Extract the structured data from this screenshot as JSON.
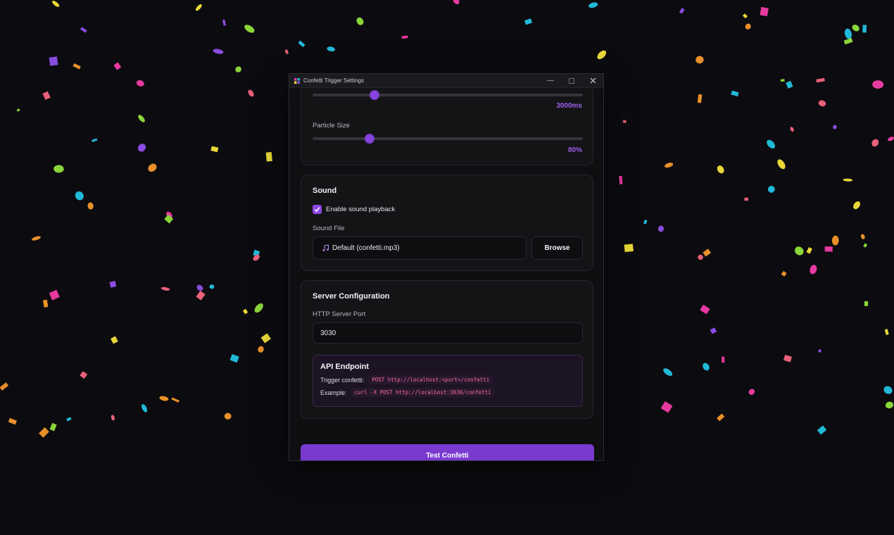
{
  "window": {
    "title": "Confetti Trigger Settings"
  },
  "sliders": [
    {
      "label": "",
      "value_text": "3000ms",
      "fraction": 0.23
    },
    {
      "label": "Particle Size",
      "value_text": "80%",
      "fraction": 0.21
    }
  ],
  "sound": {
    "title": "Sound",
    "enable_label": "Enable sound playback",
    "enabled": true,
    "file_label": "Sound File",
    "file_value": "Default (confetti.mp3)",
    "browse_label": "Browse"
  },
  "server": {
    "title": "Server Configuration",
    "port_label": "HTTP Server Port",
    "port_value": "3030",
    "api_title": "API Endpoint",
    "trigger_label": "Trigger confetti:",
    "trigger_code": "POST http://localhost:<port>/confetti",
    "example_label": "Example:",
    "example_code": "curl -X POST http://localhost:3030/confetti"
  },
  "test_button_label": "Test Confetti",
  "colors": {
    "accent": "#7a3ad0",
    "confetti": [
      "#e63aa0",
      "#22b8d8",
      "#8ad63a",
      "#e8d838",
      "#8a4ce0",
      "#e8902a",
      "#e8607a"
    ]
  }
}
